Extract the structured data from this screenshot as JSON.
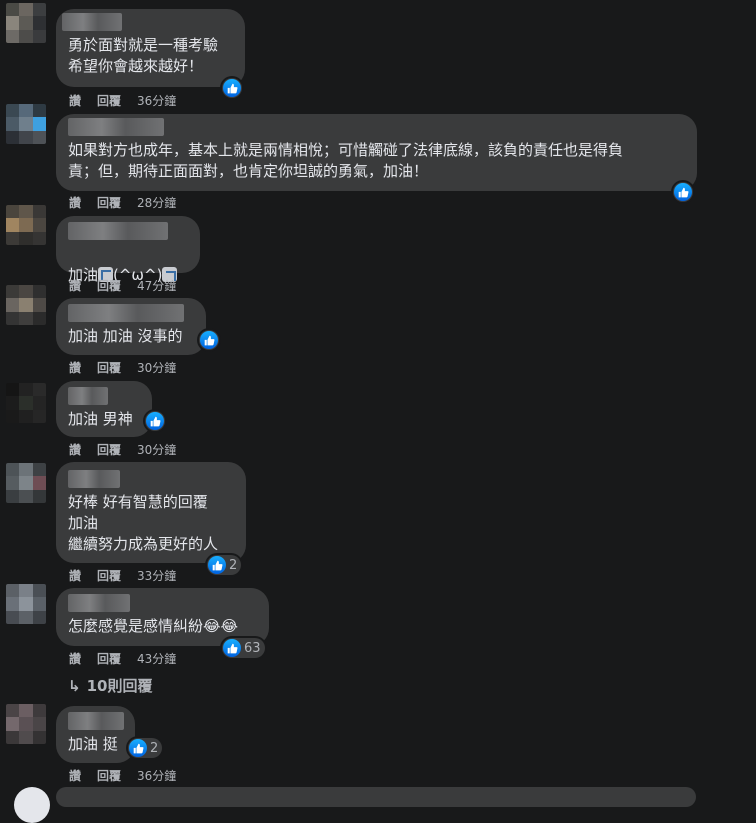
{
  "actions": {
    "like": "讚",
    "reply": "回覆"
  },
  "comments": [
    {
      "text": "勇於面對就是一種考驗\n希望你會越來越好！",
      "time": "36分鐘",
      "react_count": ""
    },
    {
      "text": "如果對方也成年，基本上就是兩情相悅；可惜觸碰了法律底線，該負的責任也是得負\n責；但，期待正面面對，也肯定你坦誠的勇氣，加油！",
      "time": "28分鐘",
      "react_count": ""
    },
    {
      "text_a": "加油",
      "text_b": "(^ω^)",
      "time": "47分鐘"
    },
    {
      "text": "加油 加油 沒事的",
      "time": "30分鐘",
      "react_count": ""
    },
    {
      "text": "加油 男神",
      "time": "30分鐘",
      "react_count": ""
    },
    {
      "text": "好棒 好有智慧的回覆\n加油\n繼續努力成為更好的人",
      "time": "33分鐘",
      "react_count": "2"
    },
    {
      "text": "怎麼感覺是感情糾紛😂😂",
      "time": "43分鐘",
      "react_count": "63"
    },
    {
      "text": "加油 挺",
      "time": "36分鐘",
      "react_count": "2"
    }
  ],
  "replies_link": {
    "arrow": "↳",
    "label": "10則回覆"
  },
  "icons": {
    "like": "thumbs-up-icon",
    "haha": "laughing-emoji-icon",
    "reply_arrow": "reply-arrow-icon"
  },
  "colors": {
    "background": "#18191a",
    "bubble": "#3a3b3c",
    "like_blue": "#1877f2",
    "muted": "#b0b3b8"
  }
}
